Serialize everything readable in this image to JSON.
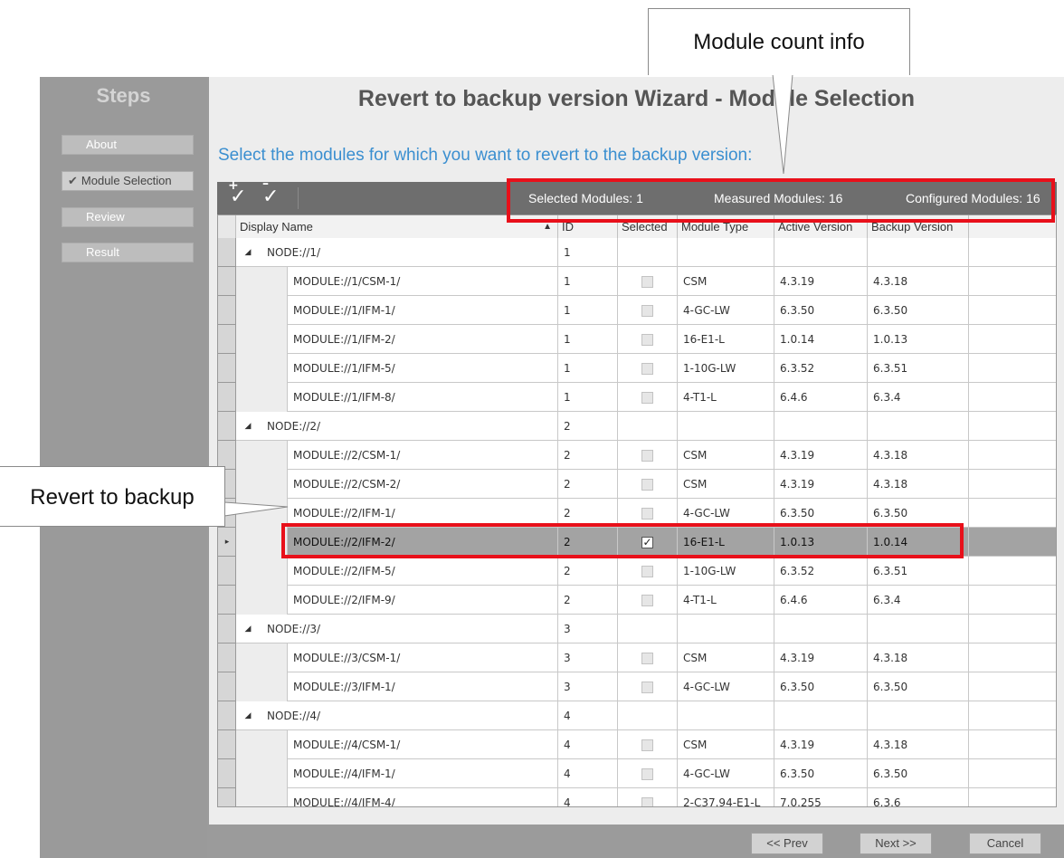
{
  "steps": {
    "title": "Steps",
    "items": [
      {
        "label": "About",
        "active": false
      },
      {
        "label": "Module Selection",
        "active": true
      },
      {
        "label": "Review",
        "active": false
      },
      {
        "label": "Result",
        "active": false
      }
    ]
  },
  "wizard": {
    "title": "Revert to backup version Wizard - Module Selection",
    "subtitle": "Select the modules for which you want to revert to the backup version:"
  },
  "toolbar": {
    "select_all_icon": "check-plus-icon",
    "deselect_all_icon": "check-minus-icon",
    "selected_modules": "Selected Modules: 1",
    "measured_modules": "Measured Modules: 16",
    "configured_modules": "Configured Modules: 16"
  },
  "grid": {
    "columns": [
      "Display Name",
      "ID",
      "Selected",
      "Module Type",
      "Active Version",
      "Backup Version"
    ],
    "rows": [
      {
        "type": "node",
        "name": "NODE://1/",
        "id": "1"
      },
      {
        "type": "module",
        "name": "MODULE://1/CSM-1/",
        "id": "1",
        "selected": false,
        "module_type": "CSM",
        "active": "4.3.19",
        "backup": "4.3.18"
      },
      {
        "type": "module",
        "name": "MODULE://1/IFM-1/",
        "id": "1",
        "selected": false,
        "module_type": "4-GC-LW",
        "active": "6.3.50",
        "backup": "6.3.50"
      },
      {
        "type": "module",
        "name": "MODULE://1/IFM-2/",
        "id": "1",
        "selected": false,
        "module_type": "16-E1-L",
        "active": "1.0.14",
        "backup": "1.0.13"
      },
      {
        "type": "module",
        "name": "MODULE://1/IFM-5/",
        "id": "1",
        "selected": false,
        "module_type": "1-10G-LW",
        "active": "6.3.52",
        "backup": "6.3.51"
      },
      {
        "type": "module",
        "name": "MODULE://1/IFM-8/",
        "id": "1",
        "selected": false,
        "module_type": "4-T1-L",
        "active": "6.4.6",
        "backup": "6.3.4"
      },
      {
        "type": "node",
        "name": "NODE://2/",
        "id": "2"
      },
      {
        "type": "module",
        "name": "MODULE://2/CSM-1/",
        "id": "2",
        "selected": false,
        "module_type": "CSM",
        "active": "4.3.19",
        "backup": "4.3.18"
      },
      {
        "type": "module",
        "name": "MODULE://2/CSM-2/",
        "id": "2",
        "selected": false,
        "module_type": "CSM",
        "active": "4.3.19",
        "backup": "4.3.18"
      },
      {
        "type": "module",
        "name": "MODULE://2/IFM-1/",
        "id": "2",
        "selected": false,
        "module_type": "4-GC-LW",
        "active": "6.3.50",
        "backup": "6.3.50"
      },
      {
        "type": "module",
        "name": "MODULE://2/IFM-2/",
        "id": "2",
        "selected": true,
        "current": true,
        "module_type": "16-E1-L",
        "active": "1.0.13",
        "backup": "1.0.14"
      },
      {
        "type": "module",
        "name": "MODULE://2/IFM-5/",
        "id": "2",
        "selected": false,
        "module_type": "1-10G-LW",
        "active": "6.3.52",
        "backup": "6.3.51"
      },
      {
        "type": "module",
        "name": "MODULE://2/IFM-9/",
        "id": "2",
        "selected": false,
        "module_type": "4-T1-L",
        "active": "6.4.6",
        "backup": "6.3.4"
      },
      {
        "type": "node",
        "name": "NODE://3/",
        "id": "3"
      },
      {
        "type": "module",
        "name": "MODULE://3/CSM-1/",
        "id": "3",
        "selected": false,
        "module_type": "CSM",
        "active": "4.3.19",
        "backup": "4.3.18"
      },
      {
        "type": "module",
        "name": "MODULE://3/IFM-1/",
        "id": "3",
        "selected": false,
        "module_type": "4-GC-LW",
        "active": "6.3.50",
        "backup": "6.3.50"
      },
      {
        "type": "node",
        "name": "NODE://4/",
        "id": "4"
      },
      {
        "type": "module",
        "name": "MODULE://4/CSM-1/",
        "id": "4",
        "selected": false,
        "module_type": "CSM",
        "active": "4.3.19",
        "backup": "4.3.18"
      },
      {
        "type": "module",
        "name": "MODULE://4/IFM-1/",
        "id": "4",
        "selected": false,
        "module_type": "4-GC-LW",
        "active": "6.3.50",
        "backup": "6.3.50"
      },
      {
        "type": "module",
        "name": "MODULE://4/IFM-4/",
        "id": "4",
        "selected": false,
        "module_type": "2-C37.94-E1-L",
        "active": "7.0.255",
        "backup": "6.3.6"
      }
    ]
  },
  "buttons": {
    "prev": "<< Prev",
    "next": "Next >>",
    "cancel": "Cancel"
  },
  "callouts": {
    "module_count": "Module count info",
    "revert": "Revert to backup"
  },
  "colors": {
    "highlight": "#e8101a",
    "subtitle": "#3b8fd0",
    "selected_row": "#a3a3a3"
  }
}
